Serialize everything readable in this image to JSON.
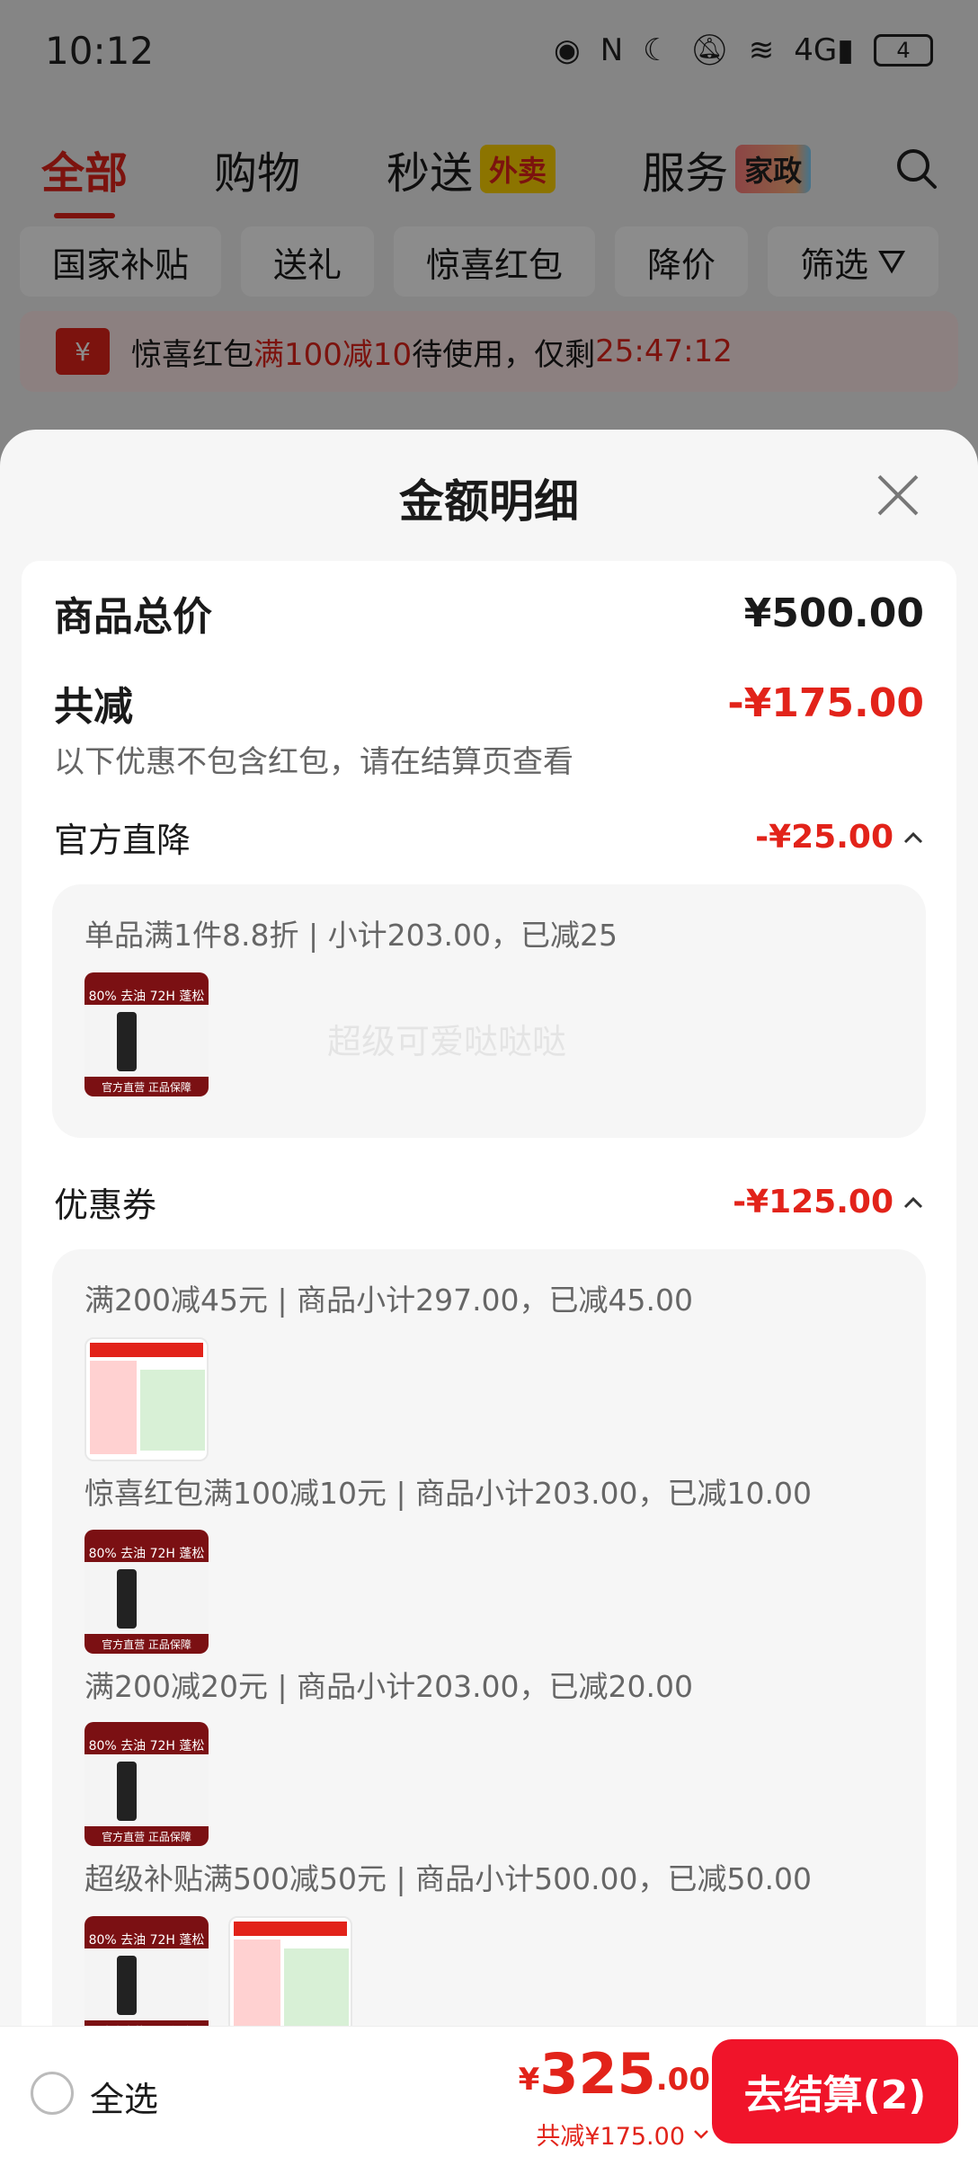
{
  "status_bar": {
    "time": "10:12",
    "battery": "4"
  },
  "top_tabs": [
    {
      "label": "全部",
      "active": true
    },
    {
      "label": "购物"
    },
    {
      "label": "秒送",
      "badge": "外卖"
    },
    {
      "label": "服务",
      "badge": "家政"
    }
  ],
  "filter_chips": [
    "国家补贴",
    "送礼",
    "惊喜红包",
    "降价",
    "筛选"
  ],
  "promo_bar": {
    "prefix": "惊喜红包",
    "highlight": "满100减10",
    "middle": "待使用，仅剩",
    "countdown": "25:47:12",
    "icon_text": "¥"
  },
  "sheet": {
    "title": "金额明细",
    "goods_total_label": "商品总价",
    "goods_total_value": "¥500.00",
    "reduce_label": "共减",
    "reduce_value": "-¥175.00",
    "reduce_note": "以下优惠不包含红包，请在结算页查看",
    "official": {
      "title": "官方直降",
      "amount": "-¥25.00",
      "lines": [
        "单品满1件8.8折 | 小计203.00，已减25"
      ]
    },
    "coupon": {
      "title": "优惠券",
      "amount": "-¥125.00",
      "lines": [
        "满200减45元 | 商品小计297.00，已减45.00",
        "惊喜红包满100减10元 | 商品小计203.00，已减10.00",
        "满200减20元 | 商品小计203.00，已减20.00",
        "超级补贴满500减50元 | 商品小计500.00，已减50.00"
      ]
    },
    "watermark": "超级可爱哒哒哒"
  },
  "thumb_text": {
    "top": "80% 去油  72H 蓬松",
    "bottom": "官方直营  正品保障"
  },
  "bottom_bar": {
    "select_all": "全选",
    "currency": "¥",
    "total_int": "325",
    "total_dec": ".00",
    "total_reduce": "共减¥175.00",
    "checkout": "去结算(2)"
  },
  "colors": {
    "accent": "#e2231a",
    "checkout": "#f0142a"
  }
}
